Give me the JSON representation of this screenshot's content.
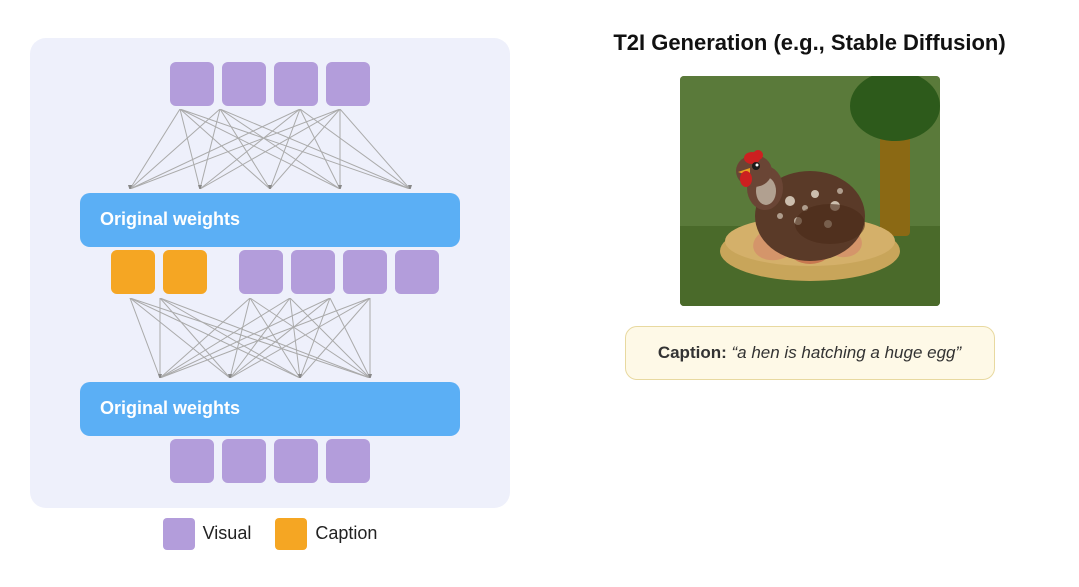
{
  "left": {
    "legend": {
      "visual_label": "Visual",
      "caption_label": "Caption"
    },
    "top_nodes": [
      "purple",
      "purple",
      "purple",
      "purple"
    ],
    "mid_nodes_left": [
      "orange",
      "orange"
    ],
    "mid_nodes_right": [
      "purple",
      "purple",
      "purple",
      "purple"
    ],
    "bottom_nodes": [
      "purple",
      "purple",
      "purple",
      "purple"
    ],
    "weight_bar_top": "Original weights",
    "weight_bar_bottom": "Original weights"
  },
  "right": {
    "title": "T2I Generation (e.g., Stable Diffusion)",
    "caption_text": "Caption: “a hen is hatching a huge egg”"
  }
}
